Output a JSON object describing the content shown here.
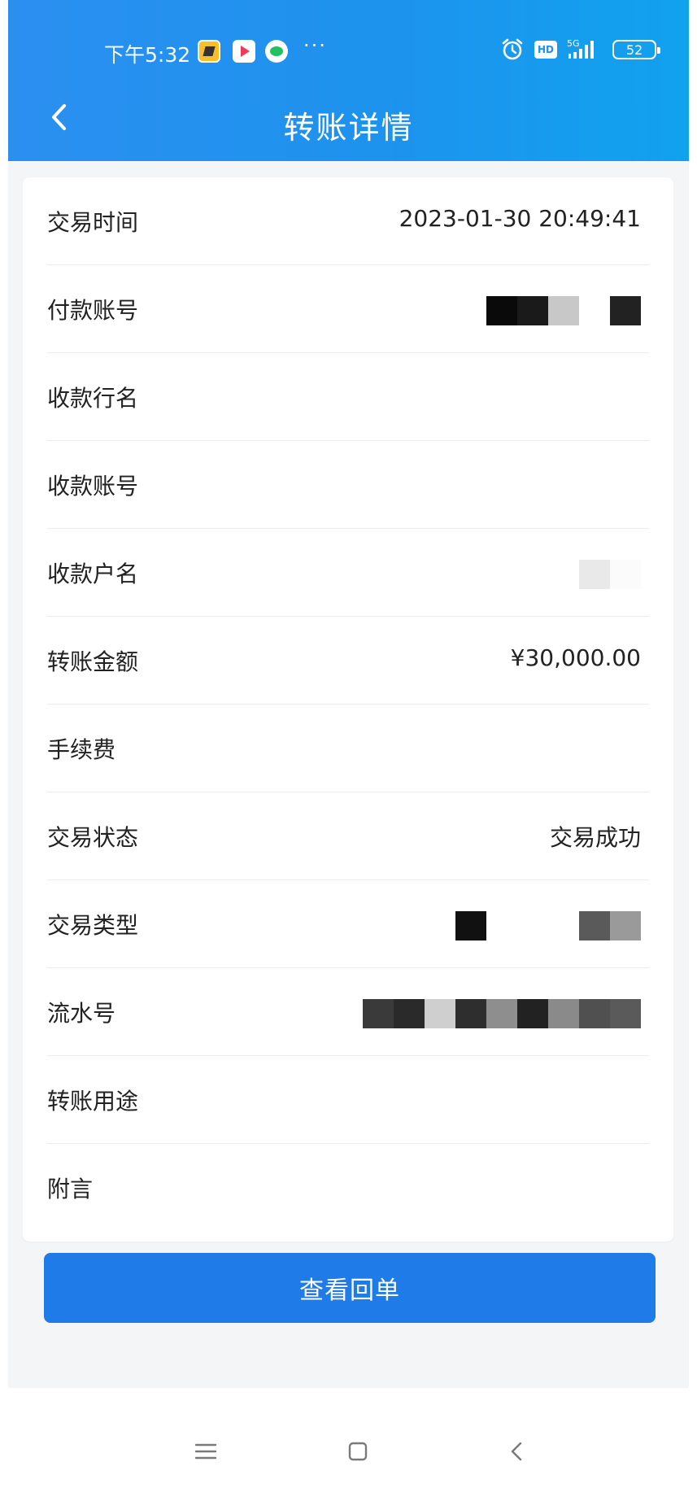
{
  "status_bar": {
    "time": "下午5:32",
    "dots": "···",
    "battery": "52"
  },
  "nav": {
    "title": "转账详情"
  },
  "details": [
    {
      "label": "交易时间",
      "value": "2023-01-30 20:49:41"
    },
    {
      "label": "付款账号",
      "value": ""
    },
    {
      "label": "收款行名",
      "value": ""
    },
    {
      "label": "收款账号",
      "value": ""
    },
    {
      "label": "收款户名",
      "value": ""
    },
    {
      "label": "转账金额",
      "value": "¥30,000.00"
    },
    {
      "label": "手续费",
      "value": ""
    },
    {
      "label": "交易状态",
      "value": "交易成功"
    },
    {
      "label": "交易类型",
      "value": ""
    },
    {
      "label": "流水号",
      "value": ""
    },
    {
      "label": "转账用途",
      "value": ""
    },
    {
      "label": "附言",
      "value": ""
    }
  ],
  "actions": {
    "receipt_label": "查看回单"
  },
  "colors": {
    "header": "#1f90ef",
    "button": "#1e7be8",
    "page_bg": "#f4f5f7"
  }
}
